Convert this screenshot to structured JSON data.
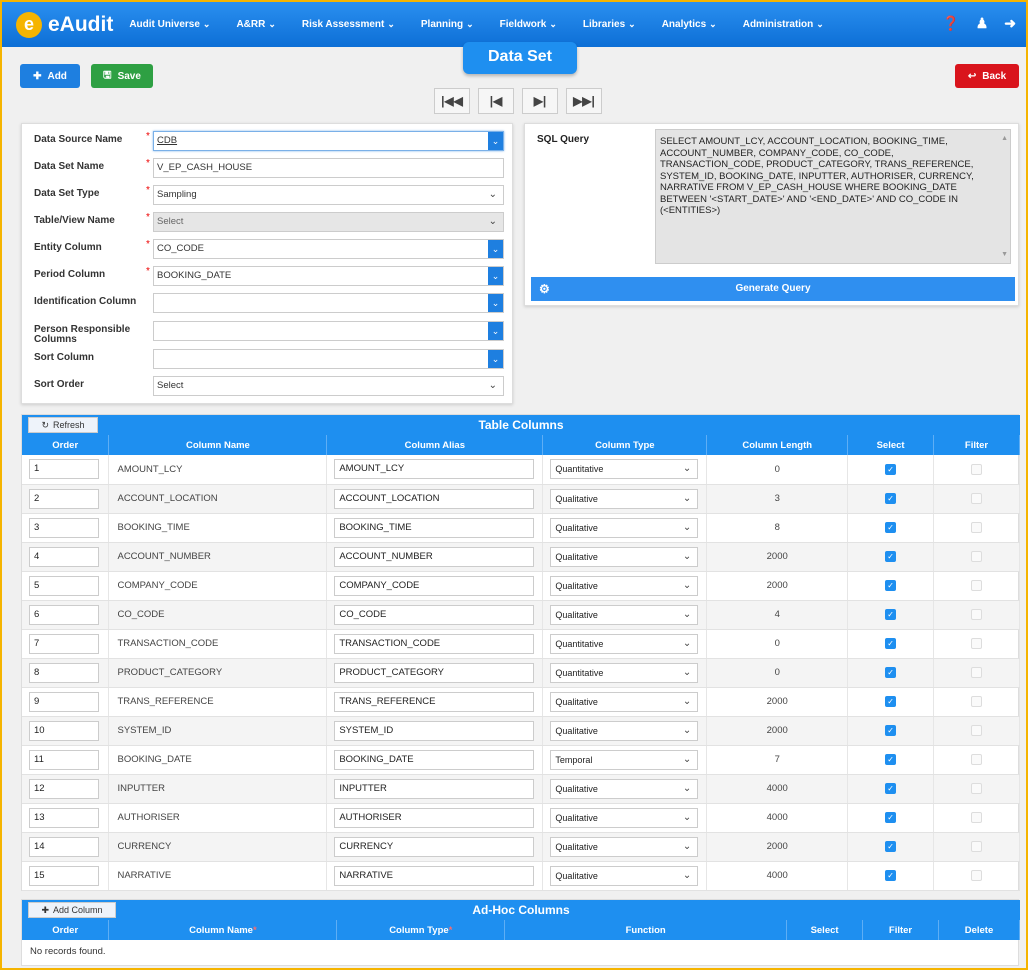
{
  "nav": {
    "app_name": "eAudit",
    "items": [
      "Audit Universe",
      "A&RR",
      "Risk Assessment",
      "Planning",
      "Fieldwork",
      "Libraries",
      "Analytics",
      "Administration"
    ]
  },
  "page_title": "Data Set",
  "toolbar": {
    "add_label": "Add",
    "save_label": "Save",
    "back_label": "Back"
  },
  "form": {
    "data_source_name": {
      "label": "Data Source Name",
      "value": "CDB"
    },
    "data_set_name": {
      "label": "Data Set Name",
      "value": "V_EP_CASH_HOUSE"
    },
    "data_set_type": {
      "label": "Data Set Type",
      "value": "Sampling"
    },
    "table_view_name": {
      "label": "Table/View Name",
      "value": "Select"
    },
    "entity_column": {
      "label": "Entity Column",
      "value": "CO_CODE"
    },
    "period_column": {
      "label": "Period Column",
      "value": "BOOKING_DATE"
    },
    "identification_column": {
      "label": "Identification Column",
      "value": ""
    },
    "person_responsible": {
      "label": "Person Responsible Columns",
      "value": ""
    },
    "sort_column": {
      "label": "Sort Column",
      "value": ""
    },
    "sort_order": {
      "label": "Sort Order",
      "value": "Select"
    }
  },
  "sql": {
    "label": "SQL Query",
    "query": "SELECT AMOUNT_LCY, ACCOUNT_LOCATION, BOOKING_TIME, ACCOUNT_NUMBER, COMPANY_CODE, CO_CODE, TRANSACTION_CODE, PRODUCT_CATEGORY, TRANS_REFERENCE, SYSTEM_ID, BOOKING_DATE, INPUTTER, AUTHORISER, CURRENCY, NARRATIVE FROM V_EP_CASH_HOUSE WHERE BOOKING_DATE BETWEEN '<START_DATE>' AND '<END_DATE>' AND CO_CODE IN (<ENTITIES>)",
    "generate_label": "Generate Query"
  },
  "table_columns": {
    "title": "Table Columns",
    "refresh_label": "Refresh",
    "headers": [
      "Order",
      "Column Name",
      "Column Alias",
      "Column Type",
      "Column Length",
      "Select",
      "Filter"
    ],
    "rows": [
      {
        "order": "1",
        "name": "AMOUNT_LCY",
        "alias": "AMOUNT_LCY",
        "type": "Quantitative",
        "length": "0"
      },
      {
        "order": "2",
        "name": "ACCOUNT_LOCATION",
        "alias": "ACCOUNT_LOCATION",
        "type": "Qualitative",
        "length": "3"
      },
      {
        "order": "3",
        "name": "BOOKING_TIME",
        "alias": "BOOKING_TIME",
        "type": "Qualitative",
        "length": "8"
      },
      {
        "order": "4",
        "name": "ACCOUNT_NUMBER",
        "alias": "ACCOUNT_NUMBER",
        "type": "Qualitative",
        "length": "2000"
      },
      {
        "order": "5",
        "name": "COMPANY_CODE",
        "alias": "COMPANY_CODE",
        "type": "Qualitative",
        "length": "2000"
      },
      {
        "order": "6",
        "name": "CO_CODE",
        "alias": "CO_CODE",
        "type": "Qualitative",
        "length": "4"
      },
      {
        "order": "7",
        "name": "TRANSACTION_CODE",
        "alias": "TRANSACTION_CODE",
        "type": "Quantitative",
        "length": "0"
      },
      {
        "order": "8",
        "name": "PRODUCT_CATEGORY",
        "alias": "PRODUCT_CATEGORY",
        "type": "Quantitative",
        "length": "0"
      },
      {
        "order": "9",
        "name": "TRANS_REFERENCE",
        "alias": "TRANS_REFERENCE",
        "type": "Qualitative",
        "length": "2000"
      },
      {
        "order": "10",
        "name": "SYSTEM_ID",
        "alias": "SYSTEM_ID",
        "type": "Qualitative",
        "length": "2000"
      },
      {
        "order": "11",
        "name": "BOOKING_DATE",
        "alias": "BOOKING_DATE",
        "type": "Temporal",
        "length": "7"
      },
      {
        "order": "12",
        "name": "INPUTTER",
        "alias": "INPUTTER",
        "type": "Qualitative",
        "length": "4000"
      },
      {
        "order": "13",
        "name": "AUTHORISER",
        "alias": "AUTHORISER",
        "type": "Qualitative",
        "length": "4000"
      },
      {
        "order": "14",
        "name": "CURRENCY",
        "alias": "CURRENCY",
        "type": "Qualitative",
        "length": "2000"
      },
      {
        "order": "15",
        "name": "NARRATIVE",
        "alias": "NARRATIVE",
        "type": "Qualitative",
        "length": "4000"
      }
    ]
  },
  "adhoc": {
    "title": "Ad-Hoc Columns",
    "add_label": "Add Column",
    "headers": [
      "Order",
      "Column Name",
      "Column Type",
      "Function",
      "Select",
      "Filter",
      "Delete"
    ],
    "empty_text": "No records found."
  },
  "colors": {
    "primary": "#1e8ff0",
    "save": "#2ea043",
    "back": "#d9141c",
    "logo": "#f5b400"
  }
}
